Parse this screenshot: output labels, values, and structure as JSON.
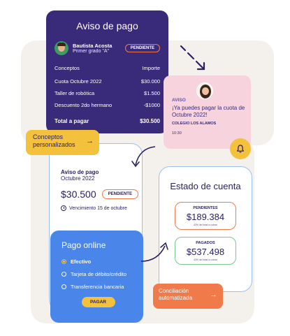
{
  "aviso_card": {
    "title": "Aviso de pago",
    "student_name": "Bautista Acosta",
    "student_grade": "Primer grado \"A\"",
    "status": "PENDIENTE",
    "col_concept": "Conceptos",
    "col_amount": "Importe",
    "items": [
      {
        "concept": "Cuota Octubre 2022",
        "amount": "$30.000"
      },
      {
        "concept": "Taller de robótica",
        "amount": "$1.500"
      },
      {
        "concept": "Descuento 2do hermano",
        "amount": "-$1000"
      }
    ],
    "total_label": "Total a pagar",
    "total_amount": "$30.500"
  },
  "notification": {
    "label": "AVISO",
    "message": "¡Ya puedes pagar la cuota de Octubre 2022!",
    "school": "COLEGIO LOS ALAMOS",
    "time": "10:30"
  },
  "tag_conceptos": {
    "label": "Conceptos personalizados",
    "icon": "arrow-right-icon"
  },
  "aviso_light": {
    "title": "Aviso de pago",
    "subtitle": "Octubre 2022",
    "amount": "$30.500",
    "status": "PENDIENTE",
    "due": "Vencimiento 15 de octubre"
  },
  "estado": {
    "title": "Estado de cuenta",
    "pending_label": "PENDIENTES",
    "pending_value": "$189.384",
    "pending_foot": "43% del total a cobrar",
    "paid_label": "PAGADOS",
    "paid_value": "$537.498",
    "paid_foot": "43% del total a cobrar"
  },
  "online": {
    "title": "Pago online",
    "options": [
      "Efectivo",
      "Tarjeta de débito/crédito",
      "Transferencia bancaria"
    ],
    "selected": "Efectivo",
    "pay_button": "PAGAR"
  },
  "tag_conciliacion": {
    "label": "Conciliación automatizada",
    "icon": "arrow-right-icon"
  },
  "colors": {
    "navy": "#3a2a7a",
    "pink": "#f6d3dd",
    "yellow": "#f3c13c",
    "blue": "#4a86ea",
    "orange": "#f07a4a",
    "green": "#79c78b"
  }
}
